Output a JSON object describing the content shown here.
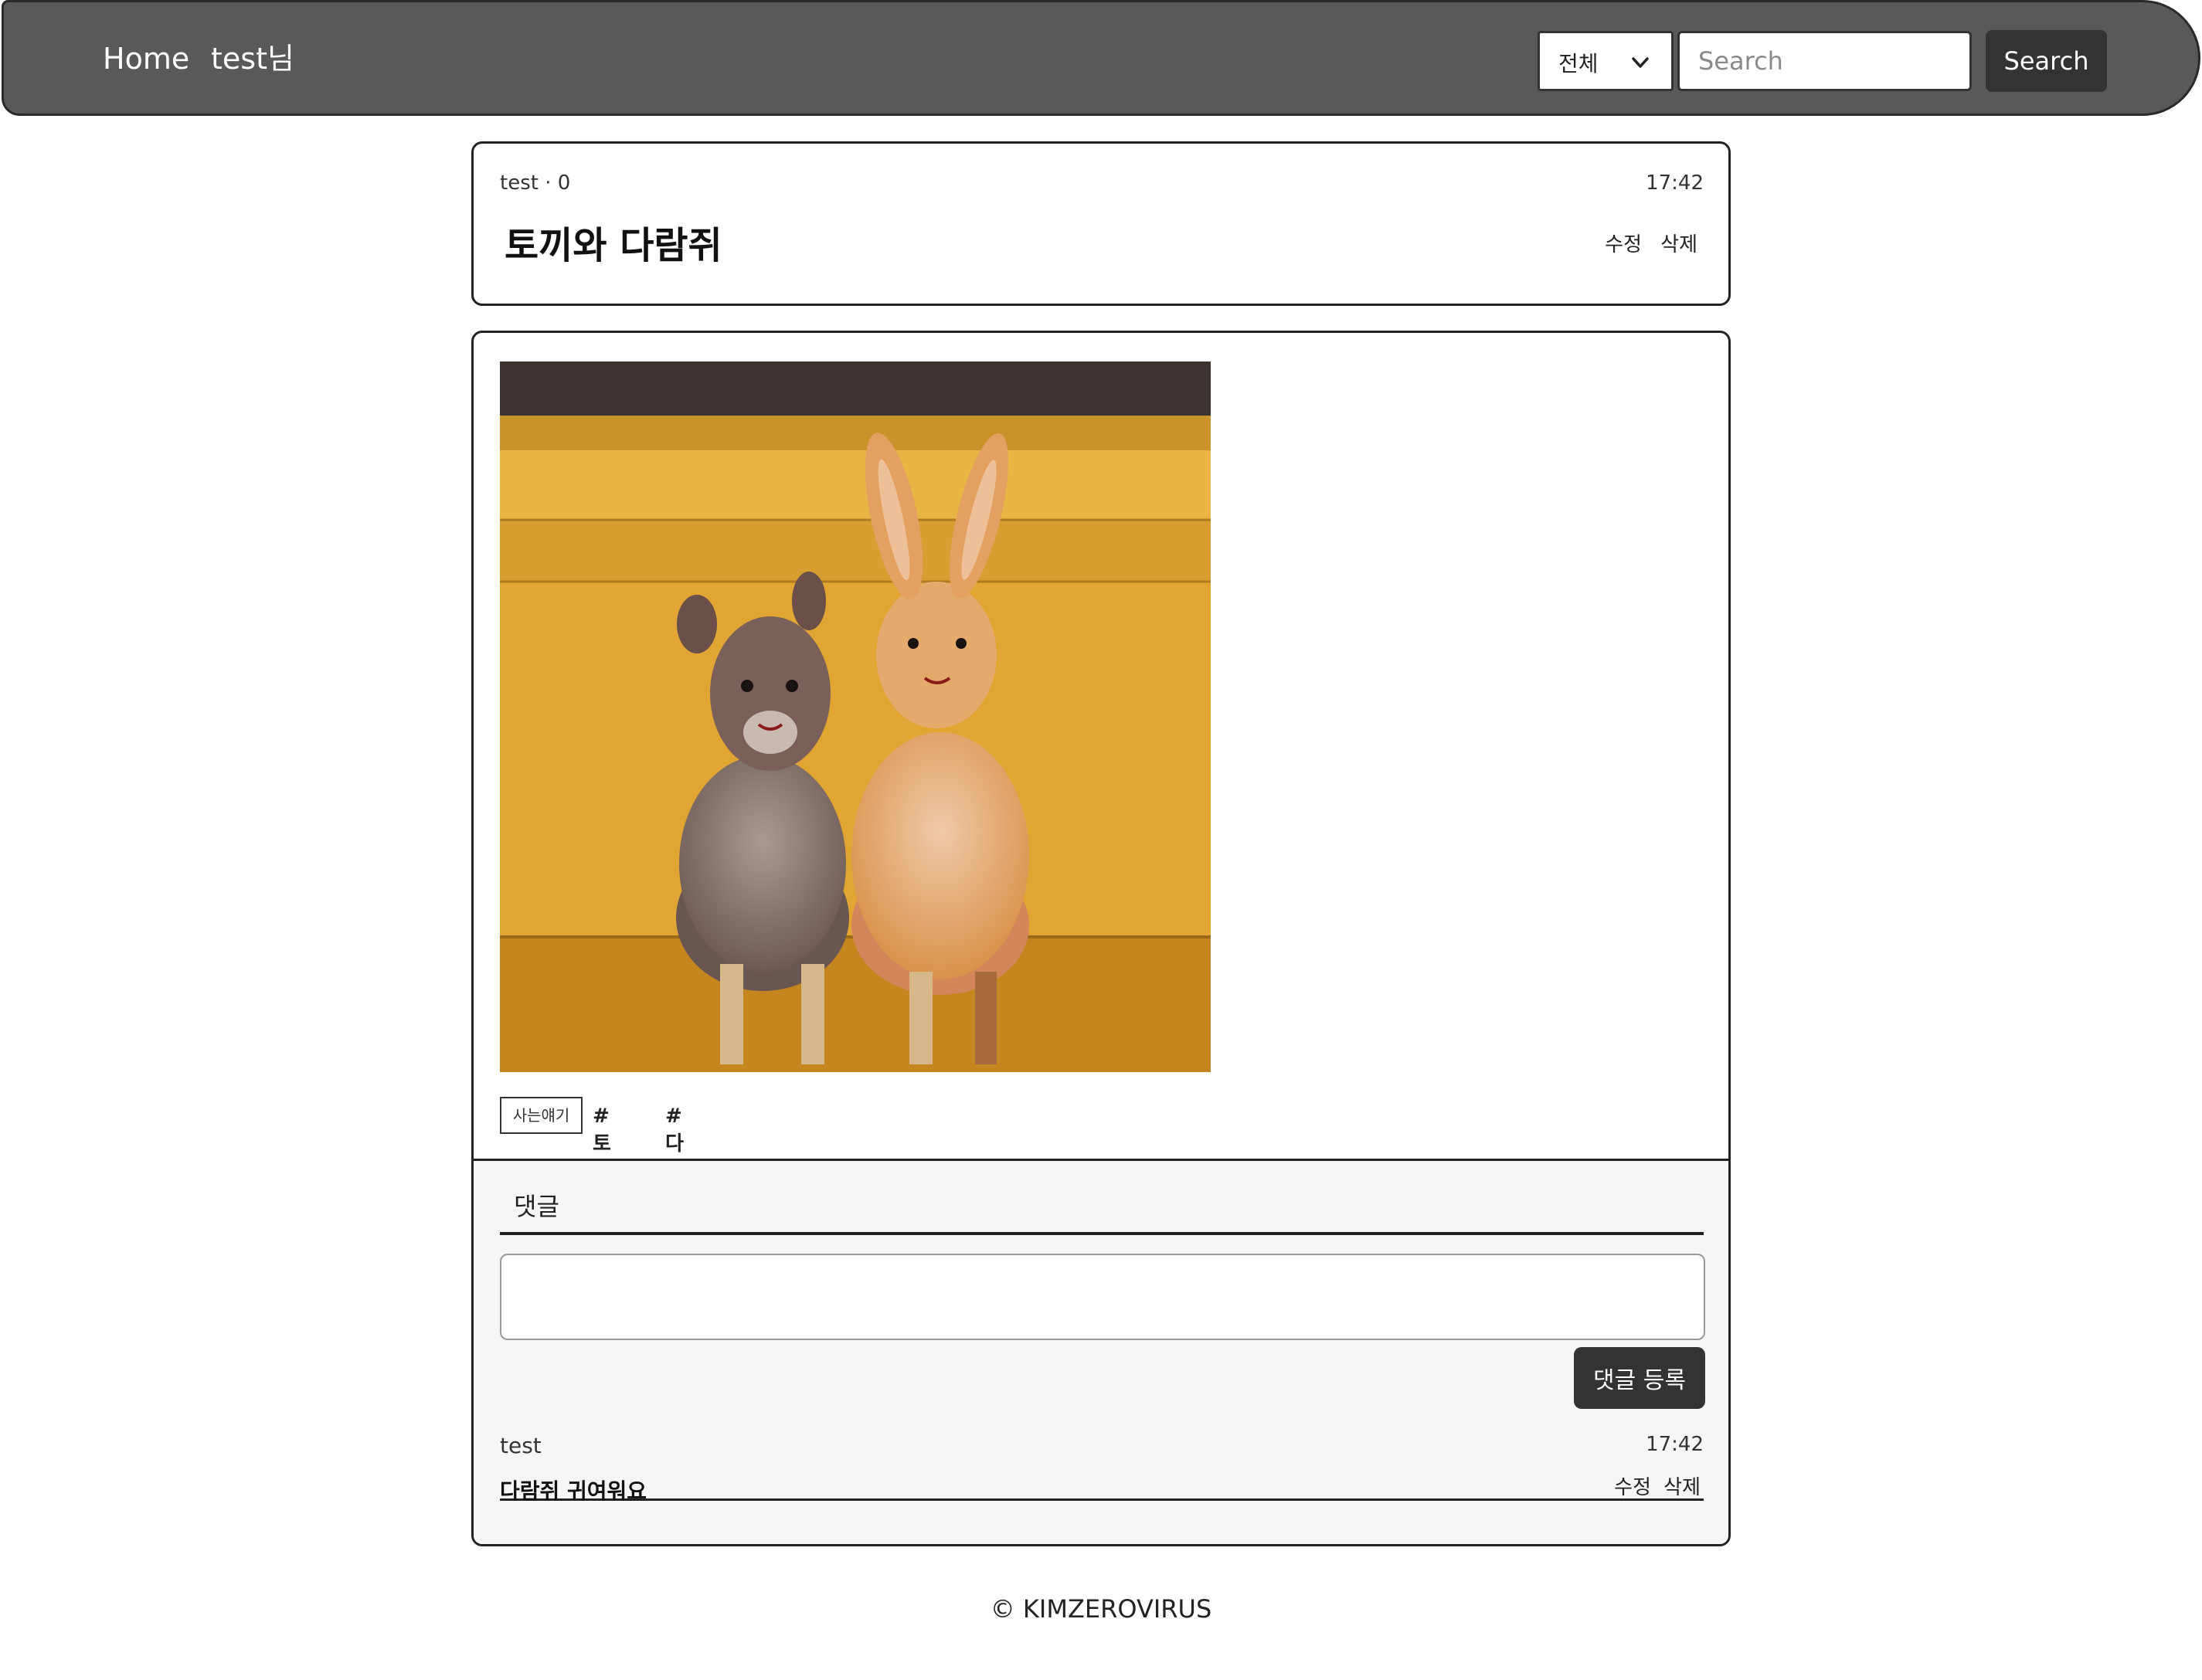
{
  "navbar": {
    "home_label": "Home",
    "user_label": "test님",
    "category_selected": "전체",
    "search_placeholder": "Search",
    "search_button_label": "Search"
  },
  "post": {
    "author_meta": "test · 0",
    "time": "17:42",
    "title": "토끼와 다람쥐",
    "edit_label": "수정",
    "delete_label": "삭제",
    "category": "사는얘기",
    "tags": [
      "#토끼",
      "#다람쥐"
    ]
  },
  "comments": {
    "heading": "댓글",
    "submit_label": "댓글 등록",
    "items": [
      {
        "author": "test",
        "time": "17:42",
        "text": "다람쥐 귀여워요",
        "edit_label": "수정",
        "delete_label": "삭제"
      }
    ]
  },
  "footer": {
    "copyright": "© KIMZEROVIRUS"
  },
  "colors": {
    "navbar_bg": "#595959",
    "button_dark": "#333333",
    "comment_bg": "#f6f6f6"
  }
}
